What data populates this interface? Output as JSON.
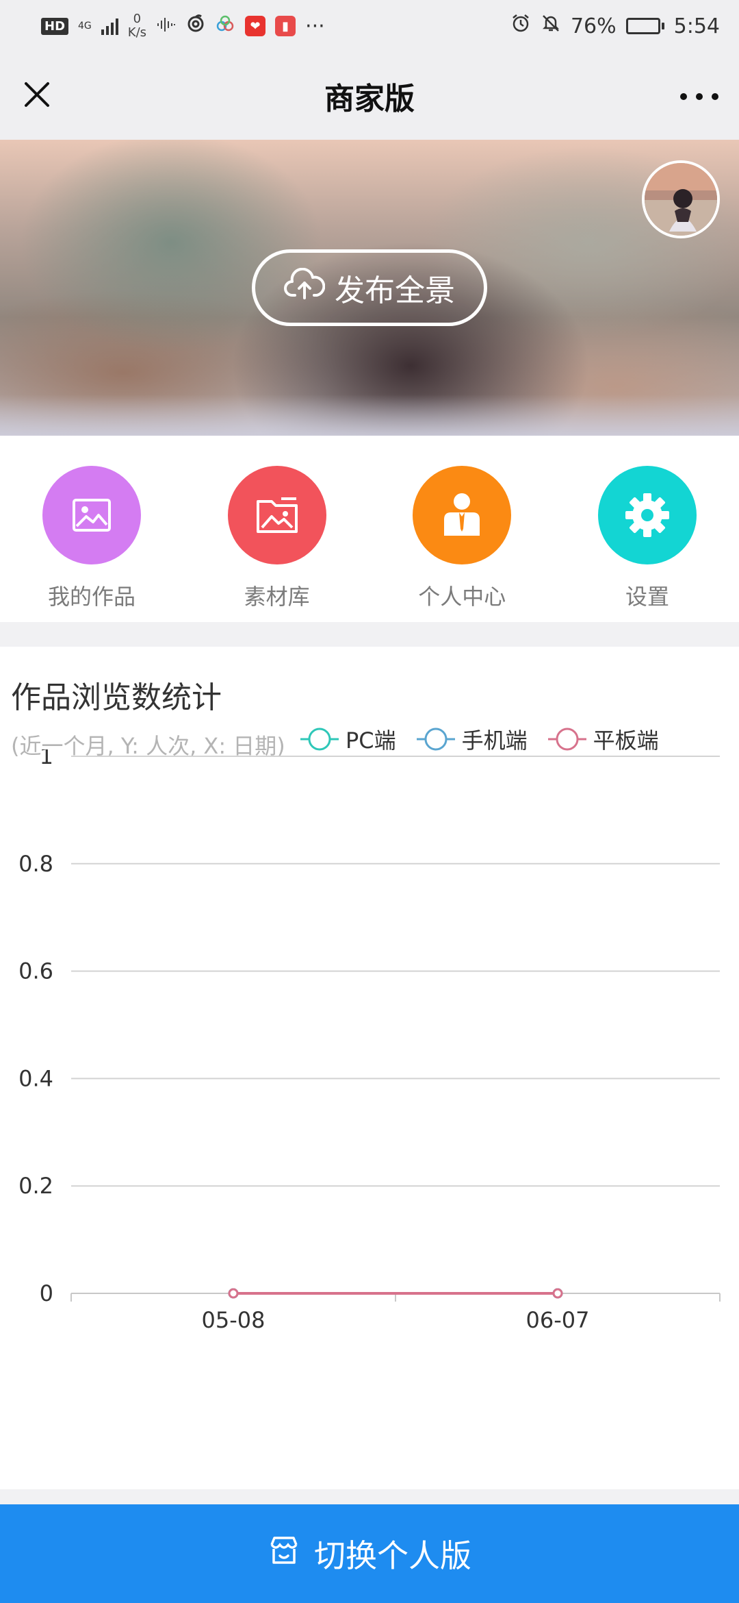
{
  "status_bar": {
    "left_chip": "HD",
    "network": "4G",
    "speed_value": "0",
    "speed_unit": "K/s",
    "more": "···",
    "battery": "76%",
    "battery_level": 0.76,
    "time": "5:54"
  },
  "nav": {
    "title": "商家版"
  },
  "banner": {
    "publish_label": "发布全景"
  },
  "menu": {
    "items": [
      {
        "label": "我的作品",
        "icon": "image-frame-icon",
        "color": "#d47cf2"
      },
      {
        "label": "素材库",
        "icon": "folder-image-icon",
        "color": "#f2535b"
      },
      {
        "label": "个人中心",
        "icon": "person-suit-icon",
        "color": "#fb8a13"
      },
      {
        "label": "设置",
        "icon": "gear-icon",
        "color": "#13d5d3"
      }
    ]
  },
  "stats": {
    "title": "作品浏览数统计",
    "subtitle": "(近一个月, Y: 人次, X: 日期)"
  },
  "chart_data": {
    "type": "line",
    "x": [
      "05-08",
      "06-07"
    ],
    "y_ticks": [
      0,
      0.2,
      0.4,
      0.6,
      0.8,
      1
    ],
    "ylim": [
      0,
      1
    ],
    "grid": true,
    "legend_position": "top-right",
    "series": [
      {
        "name": "PC端",
        "color": "#2ec7b8",
        "values": [
          0,
          0
        ]
      },
      {
        "name": "手机端",
        "color": "#5aa5d0",
        "values": [
          0,
          0
        ]
      },
      {
        "name": "平板端",
        "color": "#d7728c",
        "values": [
          0,
          0
        ]
      }
    ]
  },
  "bottom": {
    "label": "切换个人版",
    "icon": "store-icon"
  }
}
